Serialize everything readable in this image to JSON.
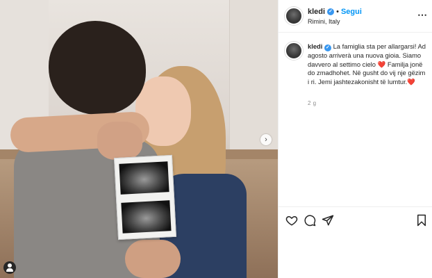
{
  "post": {
    "username": "kledi",
    "verified_mark": "✓",
    "separator": "•",
    "follow_label": "Segui",
    "location": "Rimini, Italy",
    "more_icon": "⋯",
    "caption_text": "La famiglia sta per allargarsi! Ad agosto arriverà una nuova gioia. Siamo davvero al settimo cielo ❤️ Familja jonë do zmadhohet. Në gusht do vij nje gëzim i ri. Jemi jashtezakonisht të lumtur.❤️",
    "time_ago": "2 g",
    "carousel_next": "›"
  },
  "icons": {
    "header_avatar": "avatar-icon",
    "verified": "verified-badge-icon",
    "more": "more-options-icon",
    "like": "heart-icon",
    "comment": "comment-icon",
    "share": "paper-plane-icon",
    "save": "bookmark-icon",
    "tag": "user-tag-icon",
    "next": "chevron-right-icon"
  },
  "colors": {
    "accent": "#0095f6",
    "verified": "#3897f0",
    "text": "#262626",
    "muted": "#8e8e8e",
    "border": "#efefef"
  }
}
